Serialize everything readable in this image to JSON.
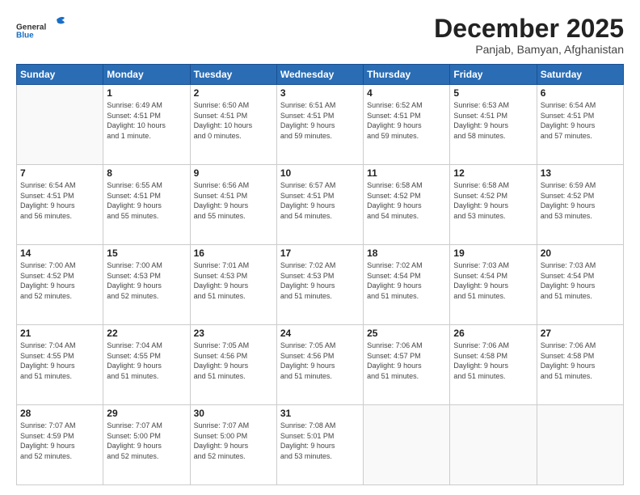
{
  "logo": {
    "general": "General",
    "blue": "Blue"
  },
  "header": {
    "month": "December 2025",
    "location": "Panjab, Bamyan, Afghanistan"
  },
  "weekdays": [
    "Sunday",
    "Monday",
    "Tuesday",
    "Wednesday",
    "Thursday",
    "Friday",
    "Saturday"
  ],
  "weeks": [
    [
      {
        "day": "",
        "info": ""
      },
      {
        "day": "1",
        "info": "Sunrise: 6:49 AM\nSunset: 4:51 PM\nDaylight: 10 hours\nand 1 minute."
      },
      {
        "day": "2",
        "info": "Sunrise: 6:50 AM\nSunset: 4:51 PM\nDaylight: 10 hours\nand 0 minutes."
      },
      {
        "day": "3",
        "info": "Sunrise: 6:51 AM\nSunset: 4:51 PM\nDaylight: 9 hours\nand 59 minutes."
      },
      {
        "day": "4",
        "info": "Sunrise: 6:52 AM\nSunset: 4:51 PM\nDaylight: 9 hours\nand 59 minutes."
      },
      {
        "day": "5",
        "info": "Sunrise: 6:53 AM\nSunset: 4:51 PM\nDaylight: 9 hours\nand 58 minutes."
      },
      {
        "day": "6",
        "info": "Sunrise: 6:54 AM\nSunset: 4:51 PM\nDaylight: 9 hours\nand 57 minutes."
      }
    ],
    [
      {
        "day": "7",
        "info": "Sunrise: 6:54 AM\nSunset: 4:51 PM\nDaylight: 9 hours\nand 56 minutes."
      },
      {
        "day": "8",
        "info": "Sunrise: 6:55 AM\nSunset: 4:51 PM\nDaylight: 9 hours\nand 55 minutes."
      },
      {
        "day": "9",
        "info": "Sunrise: 6:56 AM\nSunset: 4:51 PM\nDaylight: 9 hours\nand 55 minutes."
      },
      {
        "day": "10",
        "info": "Sunrise: 6:57 AM\nSunset: 4:51 PM\nDaylight: 9 hours\nand 54 minutes."
      },
      {
        "day": "11",
        "info": "Sunrise: 6:58 AM\nSunset: 4:52 PM\nDaylight: 9 hours\nand 54 minutes."
      },
      {
        "day": "12",
        "info": "Sunrise: 6:58 AM\nSunset: 4:52 PM\nDaylight: 9 hours\nand 53 minutes."
      },
      {
        "day": "13",
        "info": "Sunrise: 6:59 AM\nSunset: 4:52 PM\nDaylight: 9 hours\nand 53 minutes."
      }
    ],
    [
      {
        "day": "14",
        "info": "Sunrise: 7:00 AM\nSunset: 4:52 PM\nDaylight: 9 hours\nand 52 minutes."
      },
      {
        "day": "15",
        "info": "Sunrise: 7:00 AM\nSunset: 4:53 PM\nDaylight: 9 hours\nand 52 minutes."
      },
      {
        "day": "16",
        "info": "Sunrise: 7:01 AM\nSunset: 4:53 PM\nDaylight: 9 hours\nand 51 minutes."
      },
      {
        "day": "17",
        "info": "Sunrise: 7:02 AM\nSunset: 4:53 PM\nDaylight: 9 hours\nand 51 minutes."
      },
      {
        "day": "18",
        "info": "Sunrise: 7:02 AM\nSunset: 4:54 PM\nDaylight: 9 hours\nand 51 minutes."
      },
      {
        "day": "19",
        "info": "Sunrise: 7:03 AM\nSunset: 4:54 PM\nDaylight: 9 hours\nand 51 minutes."
      },
      {
        "day": "20",
        "info": "Sunrise: 7:03 AM\nSunset: 4:54 PM\nDaylight: 9 hours\nand 51 minutes."
      }
    ],
    [
      {
        "day": "21",
        "info": "Sunrise: 7:04 AM\nSunset: 4:55 PM\nDaylight: 9 hours\nand 51 minutes."
      },
      {
        "day": "22",
        "info": "Sunrise: 7:04 AM\nSunset: 4:55 PM\nDaylight: 9 hours\nand 51 minutes."
      },
      {
        "day": "23",
        "info": "Sunrise: 7:05 AM\nSunset: 4:56 PM\nDaylight: 9 hours\nand 51 minutes."
      },
      {
        "day": "24",
        "info": "Sunrise: 7:05 AM\nSunset: 4:56 PM\nDaylight: 9 hours\nand 51 minutes."
      },
      {
        "day": "25",
        "info": "Sunrise: 7:06 AM\nSunset: 4:57 PM\nDaylight: 9 hours\nand 51 minutes."
      },
      {
        "day": "26",
        "info": "Sunrise: 7:06 AM\nSunset: 4:58 PM\nDaylight: 9 hours\nand 51 minutes."
      },
      {
        "day": "27",
        "info": "Sunrise: 7:06 AM\nSunset: 4:58 PM\nDaylight: 9 hours\nand 51 minutes."
      }
    ],
    [
      {
        "day": "28",
        "info": "Sunrise: 7:07 AM\nSunset: 4:59 PM\nDaylight: 9 hours\nand 52 minutes."
      },
      {
        "day": "29",
        "info": "Sunrise: 7:07 AM\nSunset: 5:00 PM\nDaylight: 9 hours\nand 52 minutes."
      },
      {
        "day": "30",
        "info": "Sunrise: 7:07 AM\nSunset: 5:00 PM\nDaylight: 9 hours\nand 52 minutes."
      },
      {
        "day": "31",
        "info": "Sunrise: 7:08 AM\nSunset: 5:01 PM\nDaylight: 9 hours\nand 53 minutes."
      },
      {
        "day": "",
        "info": ""
      },
      {
        "day": "",
        "info": ""
      },
      {
        "day": "",
        "info": ""
      }
    ]
  ]
}
